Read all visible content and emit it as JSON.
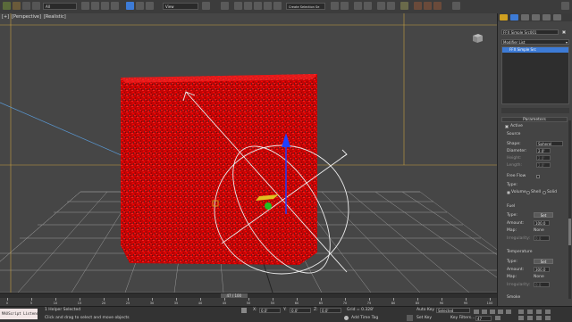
{
  "toolbar": {
    "selection_filter": "All",
    "reference_coord": "View",
    "named_selection": "Create Selection Se"
  },
  "viewport": {
    "labels": [
      "[+]",
      "[Perspective]",
      "[Realistic]"
    ]
  },
  "command_panel": {
    "object_name": "FFX Simple Src001",
    "modifier_list_label": "Modifier List",
    "stack_item": "FFX Simple Src",
    "parameters_title": "Parameters",
    "active_label": "Active",
    "active_checked": true,
    "source_title": "Source",
    "shape_label": "Shape:",
    "shape_value": "Spherel",
    "diameter_label": "Diameter:",
    "diameter_value": "2.0'",
    "height_label": "Height:",
    "height_value": "2.0'",
    "length_label": "Length:",
    "length_value": "2.0'",
    "freeflow_label": "Free Flow",
    "type_label": "Type:",
    "type_options": [
      "Volume",
      "Shell",
      "Solid"
    ],
    "fuel_title": "Fuel",
    "fuel": {
      "type_label": "Type:",
      "type_button": "Set",
      "amount_label": "Amount:",
      "amount_value": "100.0",
      "map_label": "Map:",
      "map_value": "None",
      "irregularity_label": "Irregularity:",
      "irregularity_value": "0.0"
    },
    "temperature_title": "Temperature",
    "temperature": {
      "type_label": "Type:",
      "type_button": "Set",
      "amount_label": "Amount:",
      "amount_value": "300.0",
      "map_label": "Map:",
      "map_value": "None",
      "irregularity_label": "Irregularity:",
      "irregularity_value": "0.0"
    },
    "smoke_title": "Smoke"
  },
  "timeline": {
    "frame_display": "47 / 100",
    "ticks": [
      "0",
      "5",
      "10",
      "15",
      "20",
      "25",
      "30",
      "35",
      "40",
      "45",
      "50",
      "55",
      "60",
      "65",
      "70",
      "75",
      "80",
      "85",
      "90",
      "95",
      "100"
    ],
    "progress": 0.47
  },
  "status": {
    "maxscript_label": "MAXScript Listener",
    "selection_info": "1 Helper Selected",
    "prompt": "Click and drag to select and move objects",
    "x_label": "X:",
    "x_value": "0.0'",
    "y_label": "Y:",
    "y_value": "0.0'",
    "z_label": "Z:",
    "z_value": "0.0'",
    "grid": "Grid = 0.328'",
    "auto_key": "Auto Key",
    "key_mode": "Selected",
    "set_key": "Set Key",
    "key_filters": "Key Filters...",
    "add_time_tag": "Add Time Tag",
    "frame": "47"
  },
  "colors": {
    "accent_blue": "#3d7bd6",
    "particles_red": "#e00000",
    "selection_frame": "#c8a040"
  }
}
